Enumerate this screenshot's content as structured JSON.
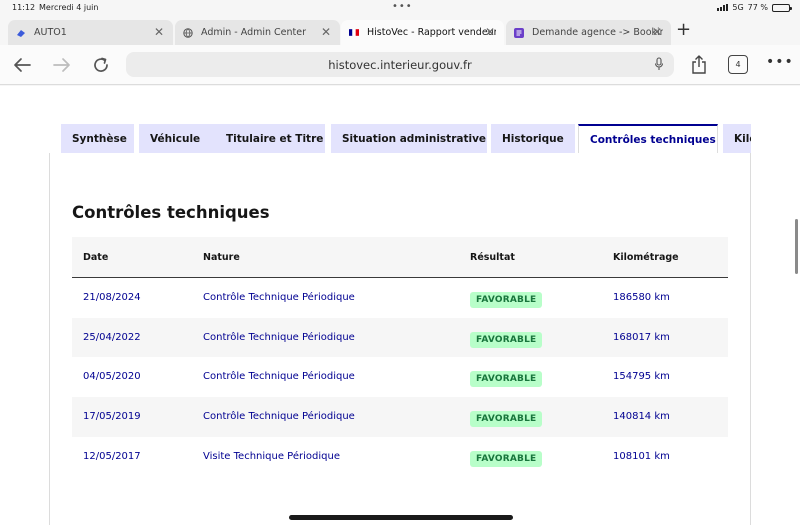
{
  "status_bar": {
    "time": "11:12",
    "date": "Mercredi 4 juin",
    "network": "5G",
    "battery": "77 %",
    "battery_level": 0.77
  },
  "browser": {
    "tabs": [
      {
        "title": "AUTO1",
        "active": false
      },
      {
        "title": "Admin - Admin Center",
        "active": false
      },
      {
        "title": "HistoVec - Rapport vendeur",
        "active": true
      },
      {
        "title": "Demande agence -> Booking",
        "active": false
      }
    ],
    "url": "histovec.interieur.gouv.fr",
    "tab_count": "4"
  },
  "page": {
    "nav_tabs": [
      {
        "label": "Synthèse",
        "active": false
      },
      {
        "label": "Véhicule",
        "active": false
      },
      {
        "label": "Titulaire et Titre",
        "active": false
      },
      {
        "label": "Situation administrative",
        "active": false
      },
      {
        "label": "Historique",
        "active": false
      },
      {
        "label": "Contrôles techniques",
        "active": true
      },
      {
        "label": "Kilométrage",
        "active": false
      }
    ],
    "heading": "Contrôles techniques",
    "table": {
      "headers": {
        "date": "Date",
        "nature": "Nature",
        "result": "Résultat",
        "mileage": "Kilométrage"
      },
      "rows": [
        {
          "date": "21/08/2024",
          "nature": "Contrôle Technique Périodique",
          "result": "FAVORABLE",
          "mileage": "186580 km"
        },
        {
          "date": "25/04/2022",
          "nature": "Contrôle Technique Périodique",
          "result": "FAVORABLE",
          "mileage": "168017 km"
        },
        {
          "date": "04/05/2020",
          "nature": "Contrôle Technique Périodique",
          "result": "FAVORABLE",
          "mileage": "154795 km"
        },
        {
          "date": "17/05/2019",
          "nature": "Contrôle Technique Périodique",
          "result": "FAVORABLE",
          "mileage": "140814 km"
        },
        {
          "date": "12/05/2017",
          "nature": "Visite Technique Périodique",
          "result": "FAVORABLE",
          "mileage": "108101 km"
        }
      ]
    }
  },
  "colors": {
    "accent": "#000091",
    "tab_bg": "#e3e3fd",
    "badge_bg": "#b8fec9",
    "badge_text": "#18753c"
  }
}
